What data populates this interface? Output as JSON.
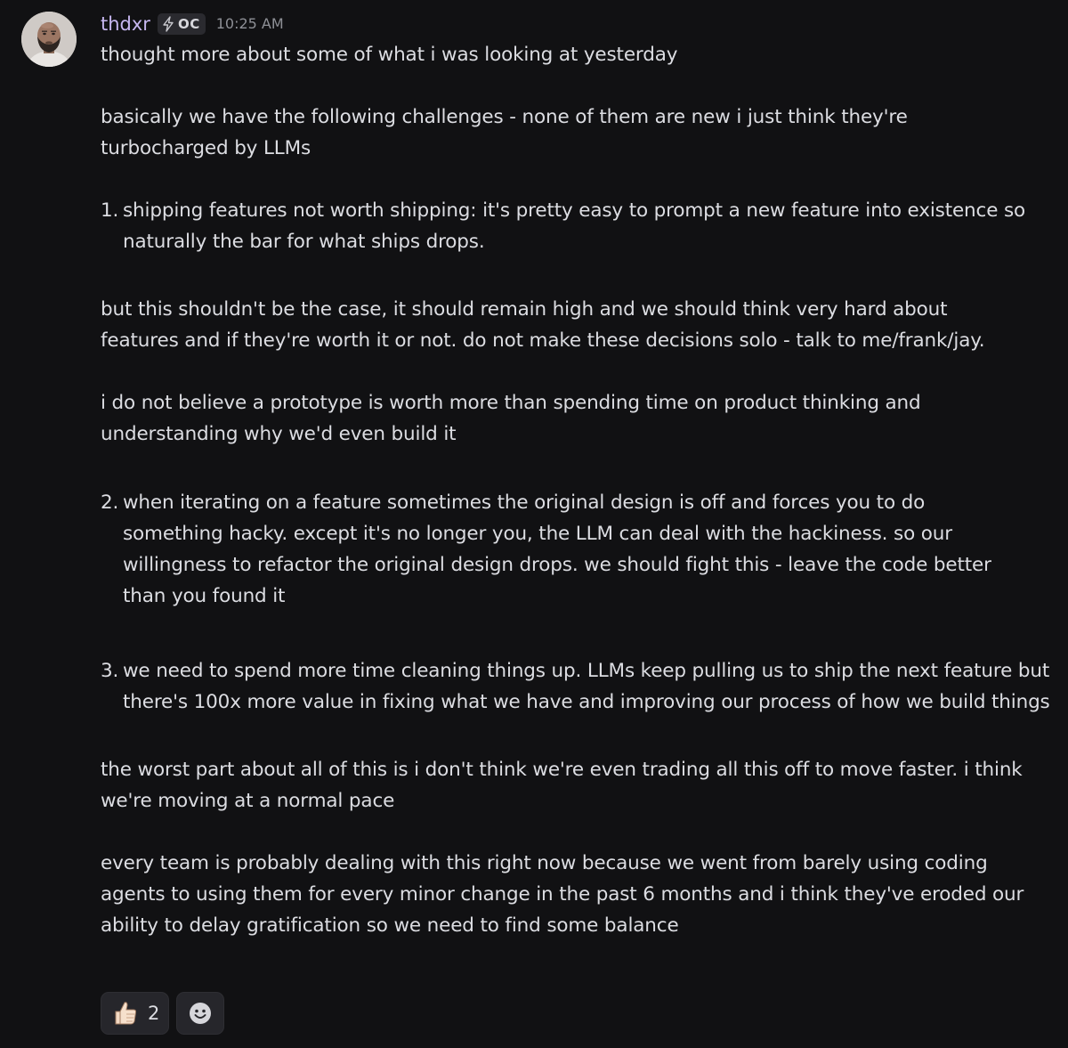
{
  "message": {
    "username": "thdxr",
    "tag": "OC",
    "timestamp": "10:25 AM",
    "paragraphs": [
      "thought more about some of what i was looking at yesterday",
      "basically we have the following challenges - none of them are new i just think they're turbocharged by LLMs",
      "but this shouldn't be the case, it should remain high and we should think very hard about features and if they're worth it or not. do not make these decisions solo - talk to me/frank/jay.",
      "i do not believe a prototype is worth more than spending time on product thinking and understanding why we'd even build it",
      "the worst part about all of this is i don't think we're even trading all this off to move faster. i think we're moving at a normal pace",
      "every team is probably dealing with this right now because we went from barely using coding agents to using them for every minor change in the past 6 months and i think they've eroded our ability to delay gratification so we need to find some balance"
    ],
    "list": [
      {
        "num": "1.",
        "text": "shipping features not worth shipping: it's pretty easy to prompt a new feature into existence so naturally the bar for what ships drops."
      },
      {
        "num": "2.",
        "text": "when iterating on a feature sometimes the original design is off and forces you to do something hacky. except it's no longer you, the LLM can deal with the hackiness. so our willingness to refactor the original design drops. we should fight this - leave the code better than you found it"
      },
      {
        "num": "3.",
        "text": "we need to spend more time cleaning things up. LLMs keep pulling us to ship the next feature but there's 100x more value in fixing what we have and improving our process of how we build things"
      }
    ]
  },
  "reactions": [
    {
      "emoji": "thumbs-up-icon",
      "count": "2"
    }
  ],
  "colors": {
    "background": "#111113",
    "username": "#c7b7f0",
    "text": "#dcdde2",
    "timestamp": "#8e9096",
    "tag_bg": "#2a2a2f"
  }
}
